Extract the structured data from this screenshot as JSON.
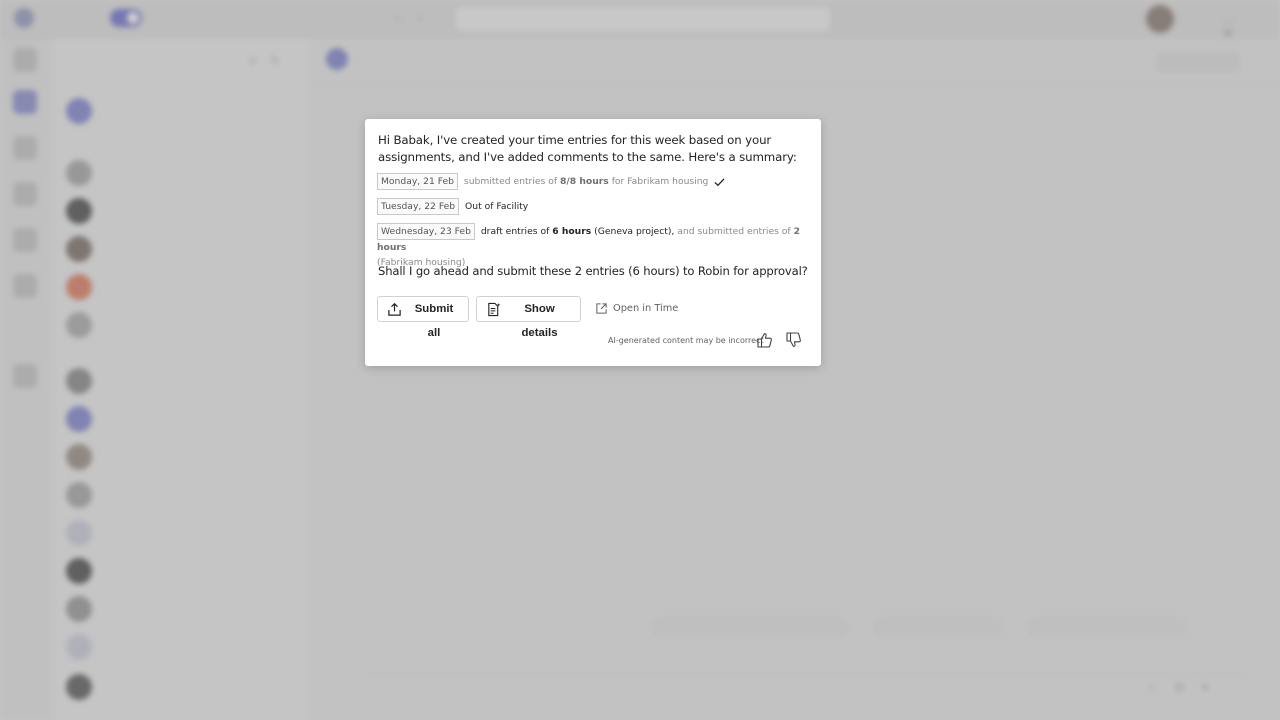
{
  "background": {
    "title_bar": {
      "app_name": "",
      "search_placeholder": ""
    },
    "chat_list": {
      "heading": "",
      "section_recent": "",
      "section_pinned": "",
      "items": [
        {
          "name": "",
          "preview": "",
          "time": ""
        },
        {
          "name": "",
          "preview": "",
          "time": ""
        },
        {
          "name": "",
          "preview": "",
          "time": ""
        },
        {
          "name": "",
          "preview": "",
          "time": ""
        },
        {
          "name": "",
          "preview": "",
          "time": ""
        },
        {
          "name": "",
          "preview": "",
          "time": ""
        },
        {
          "name": "",
          "preview": "",
          "time": ""
        },
        {
          "name": "",
          "preview": "",
          "time": ""
        },
        {
          "name": "",
          "preview": "",
          "time": ""
        },
        {
          "name": "",
          "preview": "",
          "time": ""
        },
        {
          "name": "",
          "preview": "",
          "time": ""
        },
        {
          "name": "",
          "preview": "",
          "time": ""
        },
        {
          "name": "",
          "preview": "",
          "time": ""
        },
        {
          "name": "",
          "preview": "",
          "time": ""
        },
        {
          "name": "",
          "preview": "",
          "time": ""
        }
      ]
    },
    "chat_header": {
      "name": "",
      "subtitle": ""
    }
  },
  "card": {
    "intro": "Hi Babak, I've created your time entries for this week based on your assignments, and I've added comments to the same. Here's a summary:",
    "entries": [
      {
        "date": "Monday, 21 Feb",
        "text_1": "submitted entries of",
        "hours_1": "8/8 hours",
        "text_2": "for Fabrikam housing",
        "status": "check-icon"
      },
      {
        "date": "Tuesday, 22 Feb",
        "text_1": "Out of Facility"
      },
      {
        "date": "Wednesday, 23 Feb",
        "text_1": "draft entries of",
        "hours_1": "6 hours",
        "text_2": "(Geneva project),",
        "text_3": "and submitted entries of",
        "hours_2": "2 hours",
        "text_4": "(Fabrikam housing)"
      }
    ],
    "question": "Shall I go ahead and submit these 2 entries (6 hours) to Robin for approval?",
    "actions": {
      "submit_label": "Submit all",
      "details_label": "Show details",
      "open_label": "Open in Time"
    },
    "disclaimer": "AI-generated content may be incorrect",
    "colors": {
      "text": "#242424",
      "muted": "#8a8a8a",
      "border": "#d1d1d1",
      "overlay": "rgba(150,150,150,0.45)"
    }
  }
}
